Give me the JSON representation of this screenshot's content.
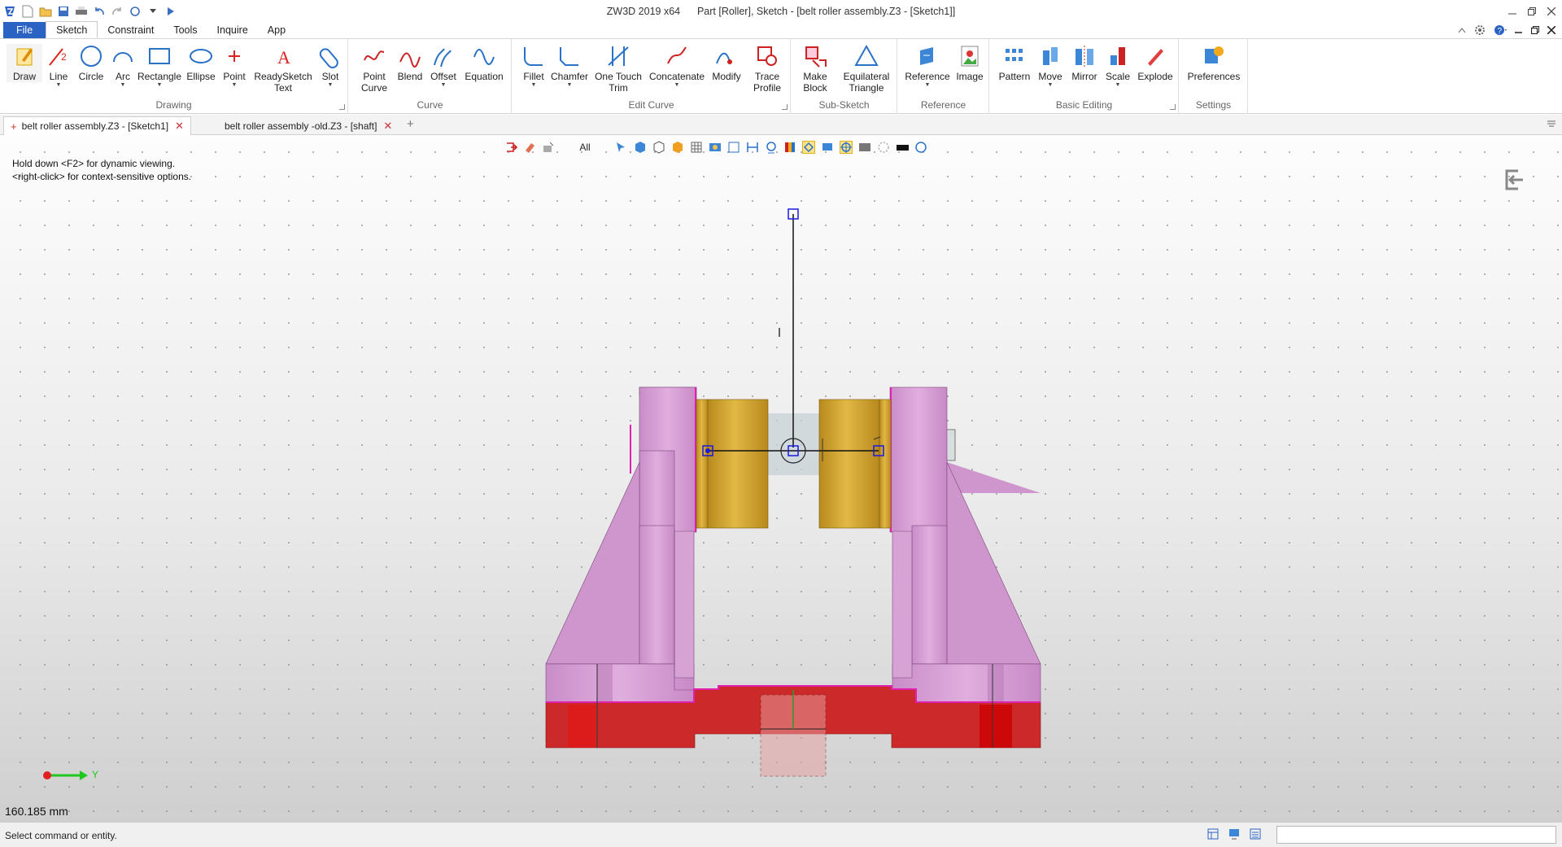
{
  "titlebar": {
    "app": "ZW3D 2019  x64",
    "doc": "Part [Roller],  Sketch - [belt roller assembly.Z3 - [Sketch1]]"
  },
  "menus": [
    "File",
    "Sketch",
    "Constraint",
    "Tools",
    "Inquire",
    "App"
  ],
  "ribbon": {
    "groups": {
      "drawing": "Drawing",
      "curve": "Curve",
      "edit_curve": "Edit Curve",
      "sub_sketch": "Sub-Sketch",
      "reference": "Reference",
      "basic_editing": "Basic Editing",
      "settings": "Settings"
    },
    "buttons": {
      "draw": "Draw",
      "line": "Line",
      "circle": "Circle",
      "arc": "Arc",
      "rectangle": "Rectangle",
      "ellipse": "Ellipse",
      "point": "Point",
      "readysketch_1": "ReadySketch",
      "readysketch_2": "Text",
      "slot": "Slot",
      "point_curve_1": "Point",
      "point_curve_2": "Curve",
      "blend": "Blend",
      "offset": "Offset",
      "equation": "Equation",
      "fillet": "Fillet",
      "chamfer": "Chamfer",
      "one_touch_1": "One Touch",
      "one_touch_2": "Trim",
      "concatenate": "Concatenate",
      "modify": "Modify",
      "trace_1": "Trace",
      "trace_2": "Profile",
      "make_block_1": "Make",
      "make_block_2": "Block",
      "eq_tri_1": "Equilateral",
      "eq_tri_2": "Triangle",
      "reference": "Reference",
      "image": "Image",
      "pattern": "Pattern",
      "move": "Move",
      "mirror": "Mirror",
      "scale": "Scale",
      "explode": "Explode",
      "preferences": "Preferences"
    }
  },
  "tabs": [
    {
      "label": "belt roller assembly.Z3 - [Sketch1]",
      "active": true
    },
    {
      "label": "belt roller assembly -old.Z3 - [shaft]",
      "active": false
    }
  ],
  "view_toolbar": {
    "filter": "All"
  },
  "viewport": {
    "hint_line1": "Hold down <F2> for dynamic viewing.",
    "hint_line2": "<right-click> for context-sensitive options.",
    "measurement": "160.185 mm",
    "axis_label": "Y"
  },
  "status": {
    "text": "Select command or entity.",
    "input_value": ""
  },
  "colors": {
    "accent": "#2a63c4",
    "bracket": "#d39bd2",
    "roller": "#d4a52a",
    "base": "#cc2a2a",
    "sketch_handle": "#1a1ae0"
  }
}
